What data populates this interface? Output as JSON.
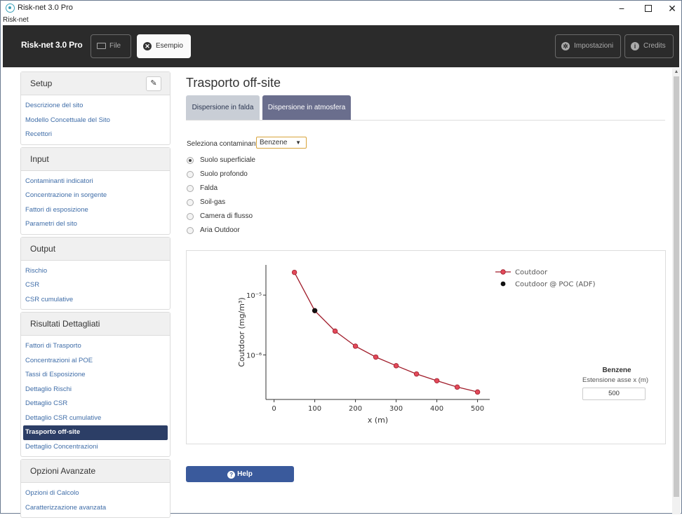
{
  "window": {
    "title": "Risk-net 3.0 Pro",
    "menu": "Risk-net",
    "min": "−",
    "close": "✕"
  },
  "navbar": {
    "brand": "Risk-net 3.0 Pro",
    "file": "File",
    "esempio": "Esempio",
    "impostazioni": "Impostazioni",
    "credits": "Credits"
  },
  "sidebar": {
    "setup": {
      "title": "Setup",
      "items": [
        "Descrizione del sito",
        "Modello Concettuale del Sito",
        "Recettori"
      ]
    },
    "input": {
      "title": "Input",
      "items": [
        "Contaminanti indicatori",
        "Concentrazione in sorgente",
        "Fattori di esposizione",
        "Parametri del sito"
      ]
    },
    "output": {
      "title": "Output",
      "items": [
        "Rischio",
        "CSR",
        "CSR cumulative"
      ]
    },
    "risultati": {
      "title": "Risultati Dettagliati",
      "items": [
        "Fattori di Trasporto",
        "Concentrazioni al POE",
        "Tassi di Esposizione",
        "Dettaglio Rischi",
        "Dettaglio CSR",
        "Dettaglio CSR cumulative",
        "Trasporto off-site",
        "Dettaglio Concentrazioni"
      ],
      "active_index": 6
    },
    "avanzate": {
      "title": "Opzioni Avanzate",
      "items": [
        "Opzioni di Calcolo",
        "Caratterizzazione avanzata"
      ]
    }
  },
  "main": {
    "title": "Trasporto off-site",
    "tabs": [
      "Dispersione in falda",
      "Dispersione in atmosfera"
    ],
    "active_tab": 1,
    "select_label": "Seleziona contaminante",
    "select_value": "Benzene",
    "radios": [
      "Suolo superficiale",
      "Suolo profondo",
      "Falda",
      "Soil-gas",
      "Camera di flusso",
      "Aria Outdoor"
    ],
    "radio_selected": 0,
    "side_title": "Benzene",
    "ext_label": "Estensione asse x (m)",
    "ext_value": "500",
    "help": "Help"
  },
  "chart_data": {
    "type": "line",
    "xlabel": "x (m)",
    "ylabel": "Coutdoor (mg/m³)",
    "y_scale": "log",
    "xlim": [
      -20,
      530
    ],
    "ylim": [
      1.8e-07,
      3.2e-05
    ],
    "xticks": [
      0,
      100,
      200,
      300,
      400,
      500
    ],
    "yticks": [
      {
        "value": 1e-05,
        "label": "10⁻⁵"
      },
      {
        "value": 1e-06,
        "label": "10⁻⁶"
      }
    ],
    "legend_position": "top-right",
    "series": [
      {
        "name": "Coutdoor",
        "color": "#a01c2a",
        "x": [
          50,
          100,
          150,
          200,
          250,
          300,
          350,
          400,
          450,
          500
        ],
        "y": [
          2.4e-05,
          5.5e-06,
          2.5e-06,
          1.4e-06,
          9.2e-07,
          6.6e-07,
          4.8e-07,
          3.7e-07,
          2.9e-07,
          2.4e-07
        ]
      },
      {
        "name": "Coutdoor @ POC (ADF)",
        "color": "#111111",
        "x": [
          100
        ],
        "y": [
          5.5e-06
        ]
      }
    ]
  }
}
